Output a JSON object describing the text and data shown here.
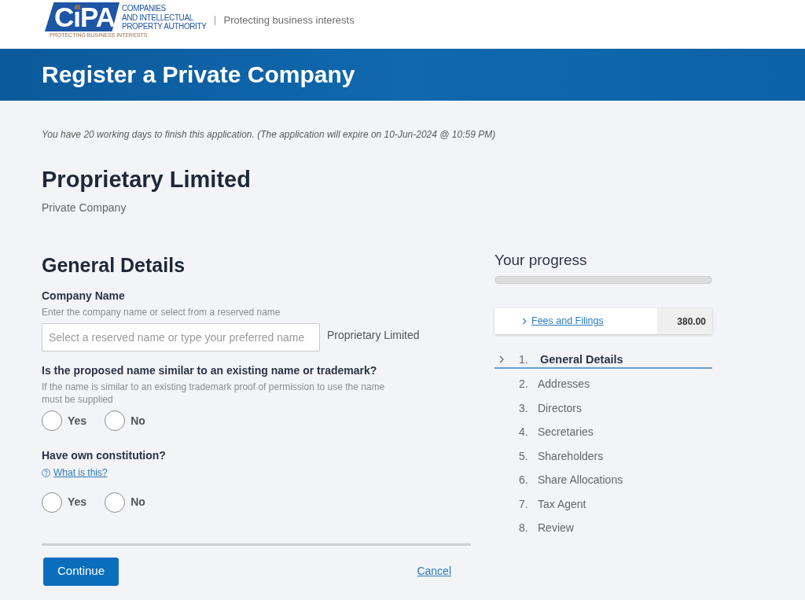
{
  "header": {
    "logo": {
      "mark": "CiPA",
      "name_lines": [
        "COMPANIES",
        "AND INTELLECTUAL",
        "PROPERTY AUTHORITY"
      ],
      "motto": "PROTECTING BUSINESS INTERESTS"
    },
    "tagline": "Protecting business interests"
  },
  "banner": {
    "title": "Register a Private Company"
  },
  "notice": "You have 20 working days to finish this application. (The application will expire on 10-Jun-2024 @ 10:59 PM)",
  "company_type": {
    "title": "Proprietary Limited",
    "subtitle": "Private Company"
  },
  "form": {
    "title": "General Details",
    "fields": [
      {
        "kind": "text",
        "label": "Company Name",
        "hint": "Enter the company name or select from a reserved name",
        "placeholder": "Select a reserved name or type your preferred name",
        "suffix": "Proprietary Limited"
      },
      {
        "kind": "radio",
        "label": "Is the proposed name similar to an existing name or trademark?",
        "hint": "If the name is similar to an existing trademark proof of permission to use the name must be supplied",
        "options": [
          {
            "label": "Yes",
            "selected": false
          },
          {
            "label": "No",
            "selected": false
          }
        ]
      },
      {
        "kind": "radio",
        "label": "Have own constitution?",
        "help_link": "What is this?",
        "options": [
          {
            "label": "Yes",
            "selected": false
          },
          {
            "label": "No",
            "selected": false
          }
        ]
      }
    ],
    "actions": {
      "primary": "Continue",
      "cancel": "Cancel"
    }
  },
  "progress": {
    "title": "Your progress",
    "level": 0,
    "fees": {
      "label": "Fees and Filings",
      "amount": "380.00"
    },
    "steps": [
      {
        "number": "1.",
        "label": "General Details",
        "selected": true
      },
      {
        "number": "2.",
        "label": "Addresses",
        "selected": false
      },
      {
        "number": "3.",
        "label": "Directors",
        "selected": false
      },
      {
        "number": "4.",
        "label": "Secretaries",
        "selected": false
      },
      {
        "number": "5.",
        "label": "Shareholders",
        "selected": false
      },
      {
        "number": "6.",
        "label": "Share Allocations",
        "selected": false
      },
      {
        "number": "7.",
        "label": "Tax Agent",
        "selected": false
      },
      {
        "number": "8.",
        "label": "Review",
        "selected": false
      }
    ]
  }
}
